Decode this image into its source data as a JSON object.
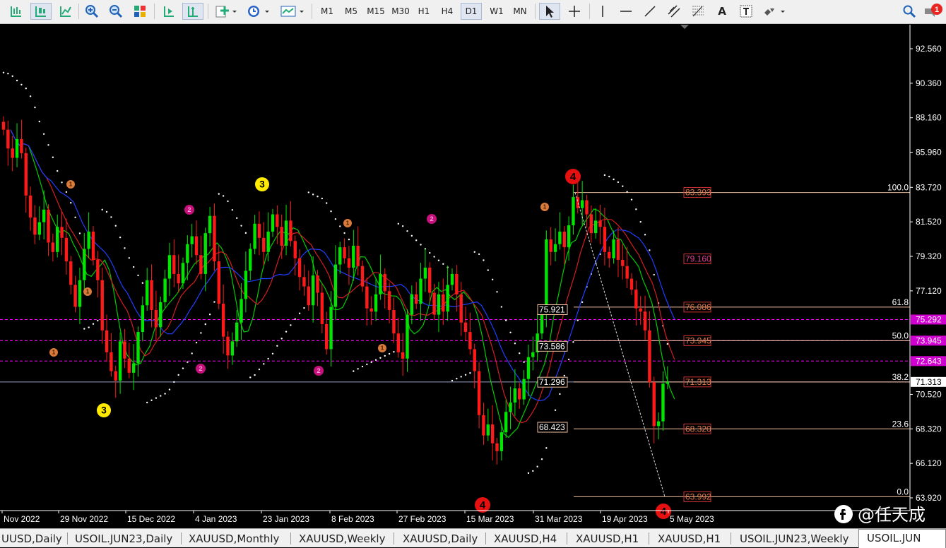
{
  "toolbar": {
    "timeframes": [
      "M1",
      "M5",
      "M15",
      "M30",
      "H1",
      "H4",
      "D1",
      "W1",
      "MN"
    ],
    "active_timeframe": "D1",
    "text_tool": "A",
    "notification_count": "1"
  },
  "colors": {
    "background": "#000000",
    "bull": "#00e600",
    "bear": "#ff1a1a",
    "ma_fast": "#00cc00",
    "ma_mid": "#d41e1e",
    "ma_slow": "#1f3fff",
    "fib": "#f0c0a0",
    "magenta": "#ff00ff",
    "wave": "#e07a3a"
  },
  "price_axis": {
    "labels": [
      "92.560",
      "90.360",
      "88.160",
      "85.960",
      "83.720",
      "81.520",
      "79.320",
      "77.120",
      "70.520",
      "68.320",
      "66.120",
      "63.920"
    ],
    "tags": [
      {
        "value": "75.292",
        "color": "#d000d0"
      },
      {
        "value": "73.945",
        "color": "#d000d0"
      },
      {
        "value": "72.643",
        "color": "#d000d0"
      },
      {
        "value": "71.313",
        "color": "#ffffff"
      }
    ]
  },
  "time_axis": [
    "Nov 2022",
    "29 Nov 2022",
    "15 Dec 2022",
    "4 Jan 2023",
    "23 Jan 2023",
    "8 Feb 2023",
    "27 Feb 2023",
    "15 Mar 2023",
    "31 Mar 2023",
    "19 Apr 2023",
    "5 May 2023"
  ],
  "fibonacci": {
    "levels": [
      {
        "pct": "100.0",
        "price": "83.393"
      },
      {
        "pct": "61.8",
        "price": "76.086"
      },
      {
        "pct": "50.0",
        "price": "73.945"
      },
      {
        "pct": "38.2",
        "price": "71.313"
      },
      {
        "pct": "23.6",
        "price": "68.320"
      },
      {
        "pct": "0.0",
        "price": "63.992"
      }
    ],
    "box_labels": [
      "75.921",
      "73.586",
      "71.296",
      "68.423"
    ],
    "extra_label": "79.160"
  },
  "wave_labels": [
    {
      "text": "3",
      "style": "yellow"
    },
    {
      "text": "3",
      "style": "yellow"
    },
    {
      "text": "4",
      "style": "red"
    },
    {
      "text": "4",
      "style": "red"
    },
    {
      "text": "4",
      "style": "red"
    },
    {
      "text": "2",
      "style": "magenta"
    },
    {
      "text": "2",
      "style": "magenta"
    },
    {
      "text": "2",
      "style": "magenta"
    },
    {
      "text": "2",
      "style": "magenta"
    },
    {
      "text": "1",
      "style": "orange"
    },
    {
      "text": "1",
      "style": "orange"
    },
    {
      "text": "1",
      "style": "orange"
    },
    {
      "text": "1",
      "style": "orange"
    },
    {
      "text": "1",
      "style": "orange"
    },
    {
      "text": "1",
      "style": "orange"
    }
  ],
  "watermark": "@任天成",
  "tabs": [
    "UUSD,Daily",
    "USOIL.JUN23,Daily",
    "XAUUSD,Monthly",
    "XAUUSD,Weekly",
    "XAUUSD,Daily",
    "XAUUSD,H4",
    "XAUUSD,H1",
    "XAUUSD,H1",
    "USOIL.JUN23,Weekly",
    "USOIL.JUN"
  ],
  "active_tab": "USOIL.JUN"
}
